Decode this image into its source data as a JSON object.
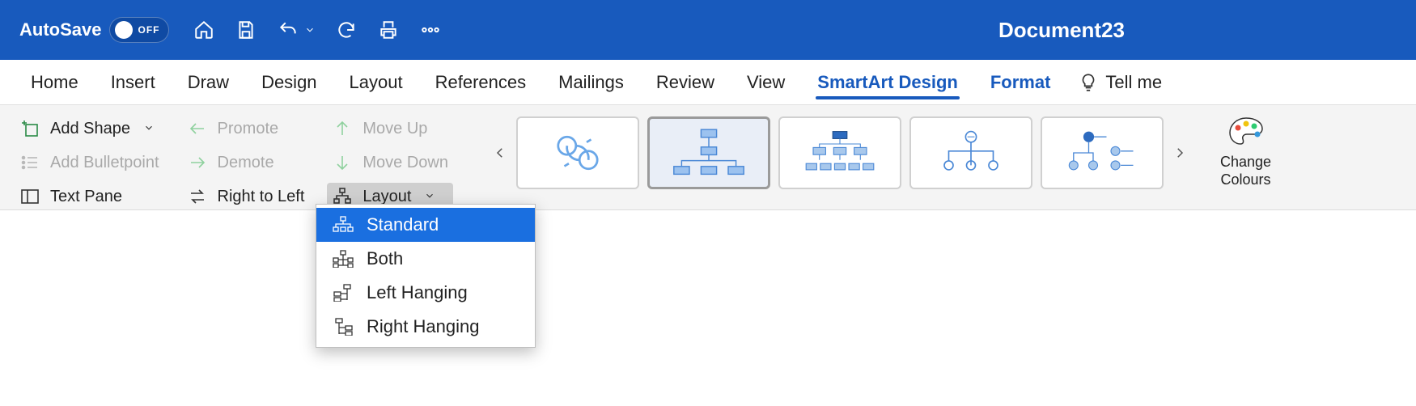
{
  "titlebar": {
    "autosave_label": "AutoSave",
    "autosave_state": "OFF",
    "document_title": "Document23"
  },
  "tabs": {
    "items": [
      {
        "label": "Home"
      },
      {
        "label": "Insert"
      },
      {
        "label": "Draw"
      },
      {
        "label": "Design"
      },
      {
        "label": "Layout"
      },
      {
        "label": "References"
      },
      {
        "label": "Mailings"
      },
      {
        "label": "Review"
      },
      {
        "label": "View"
      },
      {
        "label": "SmartArt Design"
      },
      {
        "label": "Format"
      }
    ],
    "tell_me": "Tell me"
  },
  "ribbon": {
    "col1": {
      "add_shape": "Add Shape",
      "add_bulletpoint": "Add Bulletpoint",
      "text_pane": "Text Pane"
    },
    "col2": {
      "promote": "Promote",
      "demote": "Demote",
      "right_to_left": "Right to Left"
    },
    "col3": {
      "move_up": "Move Up",
      "move_down": "Move Down",
      "layout": "Layout"
    },
    "change_colours": "Change\nColours"
  },
  "layout_menu": {
    "items": [
      {
        "label": "Standard"
      },
      {
        "label": "Both"
      },
      {
        "label": "Left Hanging"
      },
      {
        "label": "Right Hanging"
      }
    ]
  }
}
